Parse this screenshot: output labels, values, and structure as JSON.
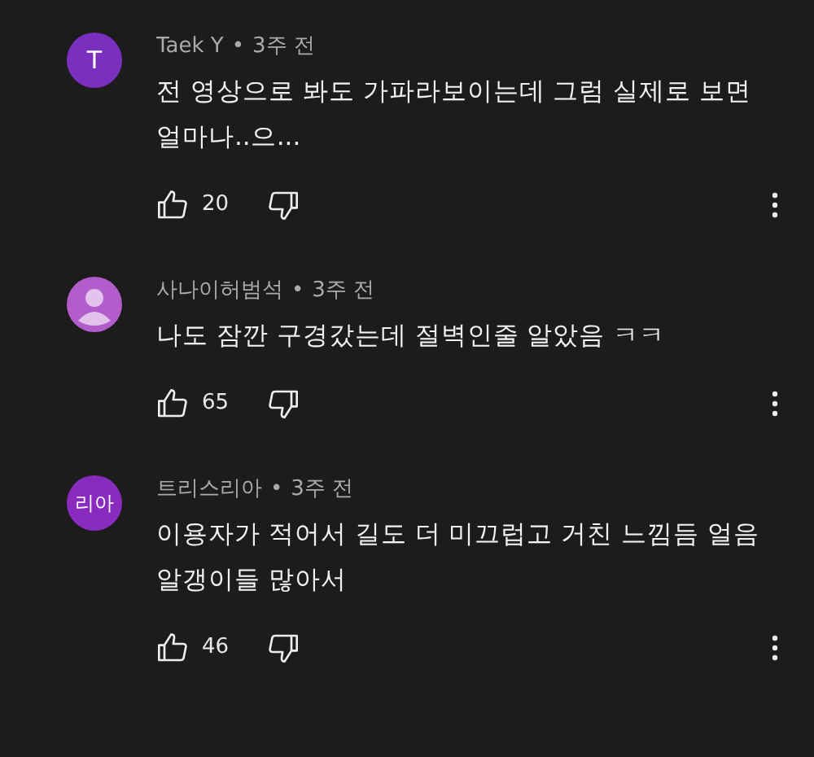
{
  "comments": [
    {
      "avatar": {
        "kind": "letter",
        "text": "T",
        "color": "#7b2fbe"
      },
      "author": "Taek Y",
      "time": "3주 전",
      "body": "전 영상으로 봐도 가파라보이는데 그럼 실제로 보면 얼마나..으...",
      "likes": "20"
    },
    {
      "avatar": {
        "kind": "silhouette",
        "color": "#b35ccc"
      },
      "author": "사나이허범석",
      "time": "3주 전",
      "body": "나도 잠깐 구경갔는데 절벽인줄 알았음 ㅋㅋ",
      "likes": "65"
    },
    {
      "avatar": {
        "kind": "letter",
        "text": "리아",
        "color": "#8a2bc0"
      },
      "author": "트리스리아",
      "time": "3주 전",
      "body": "이용자가 적어서 길도 더 미끄럽고 거친 느낌듬 얼음 알갱이들 많아서",
      "likes": "46"
    }
  ],
  "separator": "•"
}
